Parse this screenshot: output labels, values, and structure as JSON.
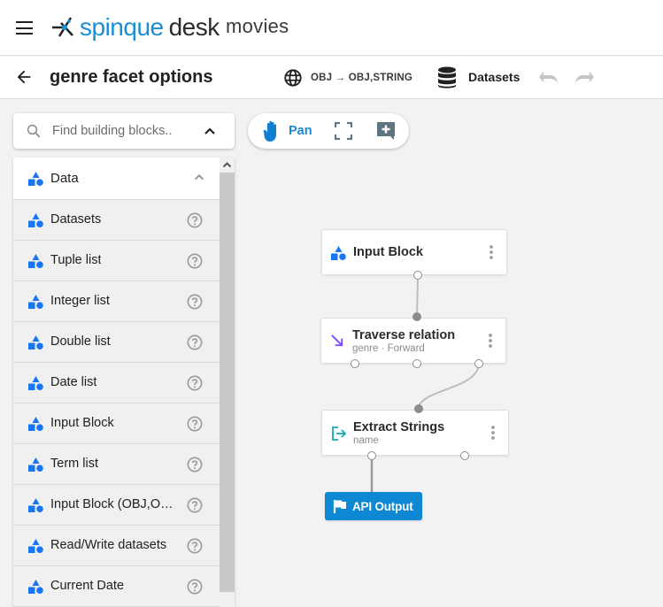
{
  "appbar": {
    "brand_primary": "spinque",
    "brand_secondary": "desk",
    "project": "movies",
    "brand_color": "#1a8fd6"
  },
  "subbar": {
    "title": "genre facet options",
    "signature_icon": "globe-icon",
    "signature": "OBJ → OBJ,STRING",
    "datasets_icon": "database-icon",
    "datasets_label": "Datasets",
    "undo_icon": "undo-icon",
    "redo_icon": "redo-icon"
  },
  "search": {
    "placeholder": "Find building blocks..",
    "value": ""
  },
  "palette": {
    "section_label": "Data",
    "section_icon": "shapes-icon",
    "accent_color": "#1976f2",
    "items": [
      {
        "label": "Datasets"
      },
      {
        "label": "Tuple list"
      },
      {
        "label": "Integer list"
      },
      {
        "label": "Double list"
      },
      {
        "label": "Date list"
      },
      {
        "label": "Input Block"
      },
      {
        "label": "Term list"
      },
      {
        "label": "Input Block (OBJ,OBJ,STRING)"
      },
      {
        "label": "Read/Write datasets"
      },
      {
        "label": "Current Date"
      }
    ]
  },
  "toolbar": {
    "pan_label": "Pan",
    "pan_icon": "hand-icon",
    "fit_icon": "fullscreen-icon",
    "comment_icon": "add-comment-icon",
    "active_color": "#1a88d0"
  },
  "graph": {
    "nodes": [
      {
        "id": "input-block",
        "title": "Input Block",
        "subtitle": "",
        "icon": "shapes-icon"
      },
      {
        "id": "traverse-relation",
        "title": "Traverse relation",
        "subtitle": "genre · Forward",
        "icon": "arrow-down-right-icon",
        "icon_color": "#7c4dff"
      },
      {
        "id": "extract-strings",
        "title": "Extract Strings",
        "subtitle": "name",
        "icon": "exit-icon",
        "icon_color": "#14a8b3"
      }
    ],
    "output": {
      "label": "API Output",
      "icon": "flag-icon",
      "color": "#0e88d3"
    }
  }
}
